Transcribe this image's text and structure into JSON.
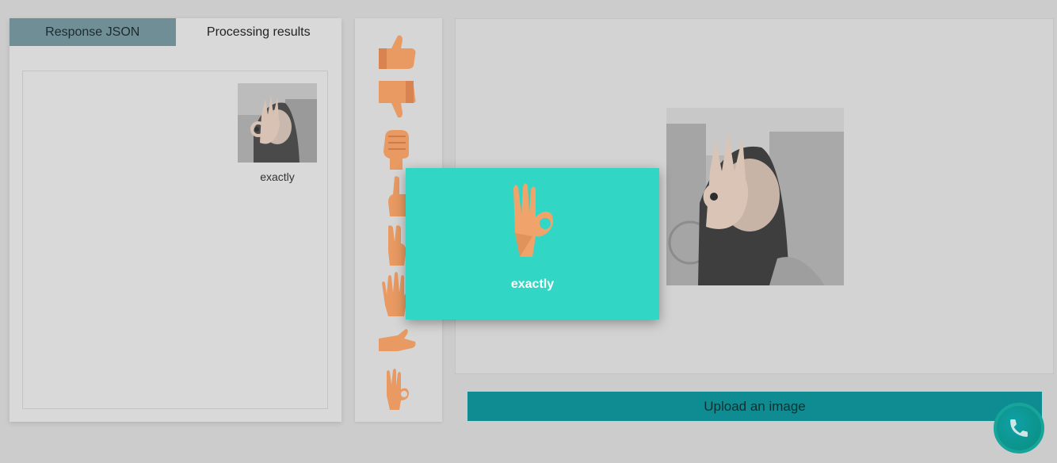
{
  "tabs": [
    {
      "label": "Response JSON",
      "active": true
    },
    {
      "label": "Processing results",
      "active": false
    }
  ],
  "results": {
    "items": [
      {
        "label": "exactly",
        "thumbnail": "webcam-snapshot-ok-gesture"
      }
    ]
  },
  "gestures": {
    "icons": [
      "thumbs-up-icon",
      "thumbs-down-icon",
      "fist-icon",
      "one-finger-icon",
      "two-fingers-icon",
      "open-palm-icon",
      "flat-hand-icon",
      "ok-sign-icon"
    ]
  },
  "modal": {
    "label": "exactly",
    "icon": "ok-sign-icon"
  },
  "upload": {
    "label": "Upload an image"
  },
  "fab": {
    "icon": "phone-icon"
  },
  "colors": {
    "accent": "#31d6c4",
    "upload_button": "#0e8c92",
    "active_tab": "#6f8e96",
    "hand": "#e89a62"
  }
}
